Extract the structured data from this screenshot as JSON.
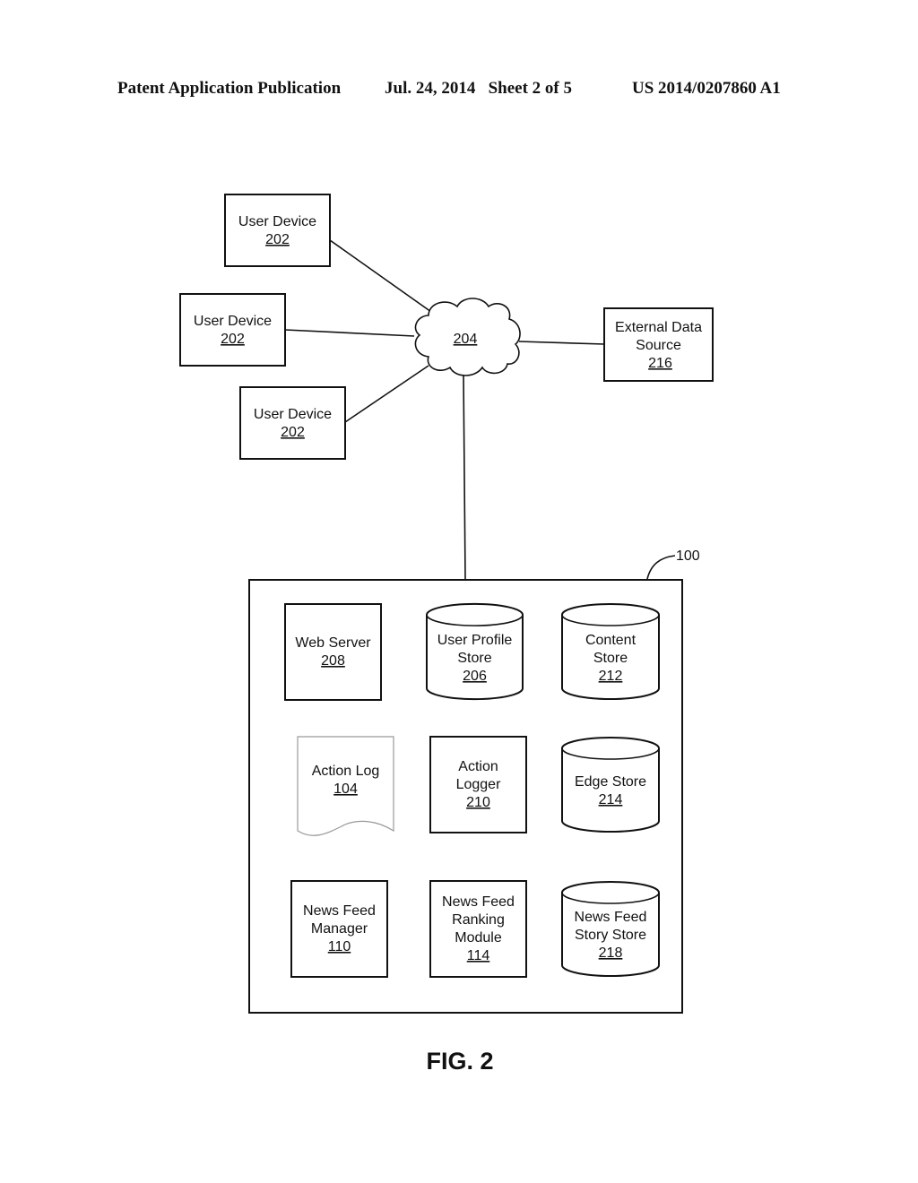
{
  "header": {
    "publication": "Patent Application Publication",
    "date_sheet": "Jul. 24, 2014   Sheet 2 of 5",
    "number": "US 2014/0207860 A1"
  },
  "figure": {
    "label": "FIG. 2",
    "system_ref": "100",
    "network": {
      "ref": "204"
    },
    "user_devices": [
      {
        "name": "User Device",
        "ref": "202"
      },
      {
        "name": "User Device",
        "ref": "202"
      },
      {
        "name": "User Device",
        "ref": "202"
      }
    ],
    "external_source": {
      "lines": [
        "External Data",
        "Source"
      ],
      "ref": "216"
    },
    "components": {
      "web_server": {
        "lines": [
          "Web Server"
        ],
        "ref": "208"
      },
      "user_profile_store": {
        "lines": [
          "User Profile",
          "Store"
        ],
        "ref": "206"
      },
      "content_store": {
        "lines": [
          "Content",
          "Store"
        ],
        "ref": "212"
      },
      "action_log": {
        "lines": [
          "Action Log"
        ],
        "ref": "104"
      },
      "action_logger": {
        "lines": [
          "Action",
          "Logger"
        ],
        "ref": "210"
      },
      "edge_store": {
        "lines": [
          "Edge Store"
        ],
        "ref": "214"
      },
      "news_feed_manager": {
        "lines": [
          "News Feed",
          "Manager"
        ],
        "ref": "110"
      },
      "ranking_module": {
        "lines": [
          "News Feed",
          "Ranking",
          "Module"
        ],
        "ref": "114"
      },
      "story_store": {
        "lines": [
          "News Feed",
          "Story Store"
        ],
        "ref": "218"
      }
    }
  }
}
